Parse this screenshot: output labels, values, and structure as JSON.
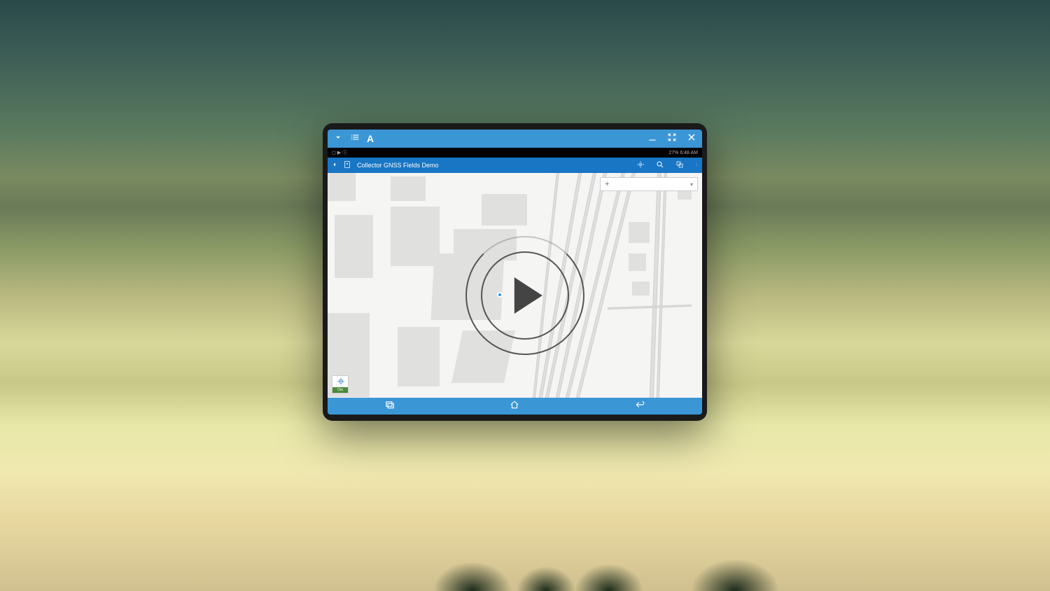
{
  "controlBar": {
    "chevronIcon": "chevron-down",
    "listIcon": "list",
    "aIcon": "A",
    "minimizeIcon": "minimize",
    "fullscreenIcon": "fullscreen",
    "closeIcon": "close"
  },
  "statusBar": {
    "leftIcons": "◻ ▶ ⓘ",
    "rightText": "27% 6:48 AM"
  },
  "appBar": {
    "backIcon": "back",
    "mapIcon": "map",
    "title": "Collector GNSS Fields Demo",
    "locateIcon": "locate",
    "searchIcon": "search",
    "layersIcon": "layers",
    "moreIcon": "more"
  },
  "map": {
    "floatingBar": {
      "plusLabel": "+",
      "dropdown": ""
    },
    "legendLabel": "Om"
  },
  "navBar": {
    "recentIcon": "recent",
    "homeIcon": "home",
    "backIcon": "back"
  },
  "playButton": {
    "label": "play"
  },
  "colors": {
    "barBlue": "#3b96d6",
    "appBarBlue": "#1976c4",
    "mapBg": "#f5f5f3"
  }
}
